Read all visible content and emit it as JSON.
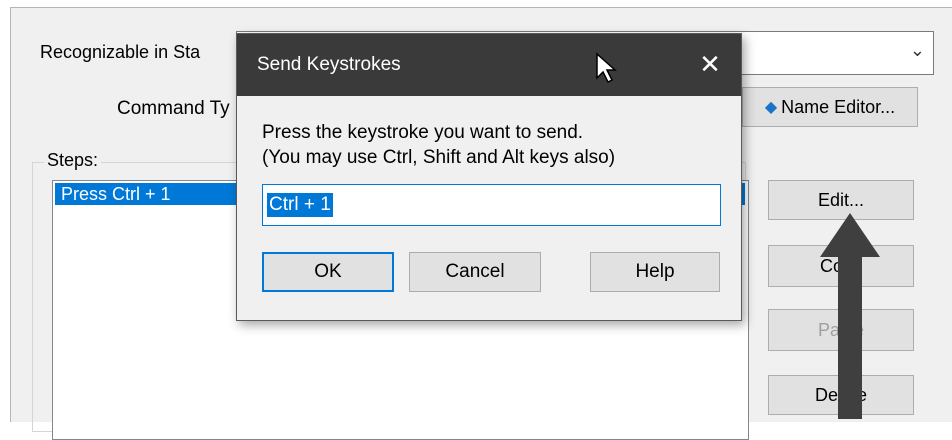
{
  "background_window": {
    "recognizable_label": "Recognizable in Sta",
    "command_type_label": "Command Ty",
    "name_editor_button": "Name Editor...",
    "steps_label": "Steps:",
    "steps": [
      "Press Ctrl + 1"
    ],
    "buttons": {
      "edit": "Edit...",
      "copy": "Copy",
      "paste": "Paste",
      "delete": "Delete"
    }
  },
  "dialog": {
    "title": "Send Keystrokes",
    "instruction_line1": "Press the keystroke you want to send.",
    "instruction_line2": "(You may use Ctrl, Shift and Alt keys also)",
    "input_value": "Ctrl + 1",
    "buttons": {
      "ok": "OK",
      "cancel": "Cancel",
      "help": "Help"
    },
    "close_icon": "close-icon"
  },
  "annotation": {
    "arrow_color": "#3f3f3f",
    "arrow_icon": "up-arrow-icon"
  },
  "colors": {
    "accent": "#0078d7",
    "titlebar": "#3a3a3a"
  }
}
